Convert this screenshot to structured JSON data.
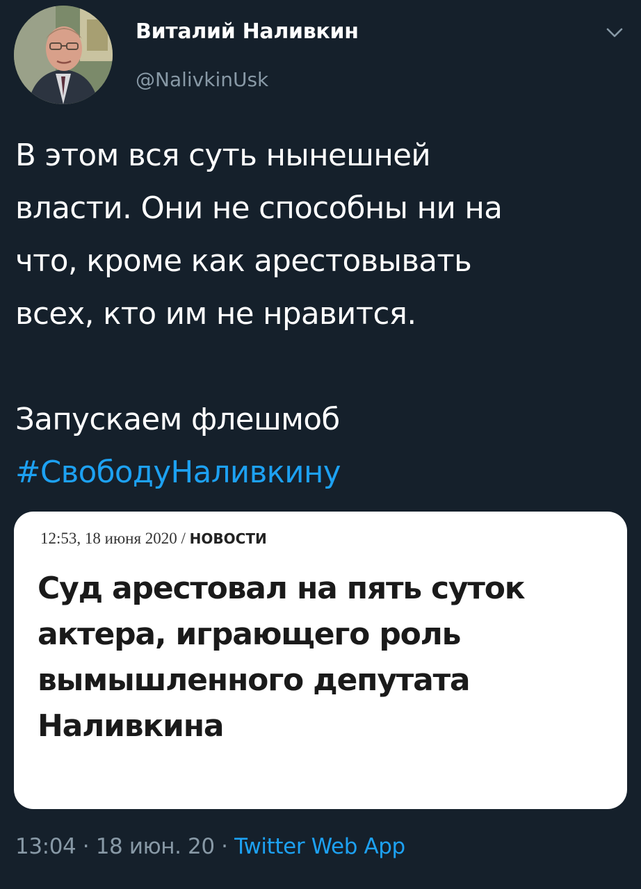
{
  "author": {
    "name": "Виталий Наливкин",
    "handle": "@NalivkinUsk"
  },
  "tweet": {
    "lines": [
      "В этом вся суть нынешней",
      "власти. Они не способны ни на",
      "что, кроме как арестовывать",
      "всех, кто им не нравится."
    ],
    "lines2": [
      "Запускаем флешмоб"
    ],
    "hashtag": "#СвободуНаливкину"
  },
  "card": {
    "meta_date": "12:53, 18 июня 2020 / ",
    "meta_section": "НОВОСТИ",
    "headline_lines": [
      "Суд арестовал на пять суток",
      "актера, играющего роль",
      "вымышленного депутата",
      "Наливкина"
    ]
  },
  "footer": {
    "time": "13:04",
    "sep1": " · ",
    "date": "18 июн. 20",
    "sep2": " · ",
    "source": "Twitter Web App"
  },
  "colors": {
    "background": "#15202b",
    "text": "#ffffff",
    "secondary": "#8899a6",
    "accent": "#1da1f2"
  },
  "icons": {
    "menu": "chevron-down-icon"
  }
}
